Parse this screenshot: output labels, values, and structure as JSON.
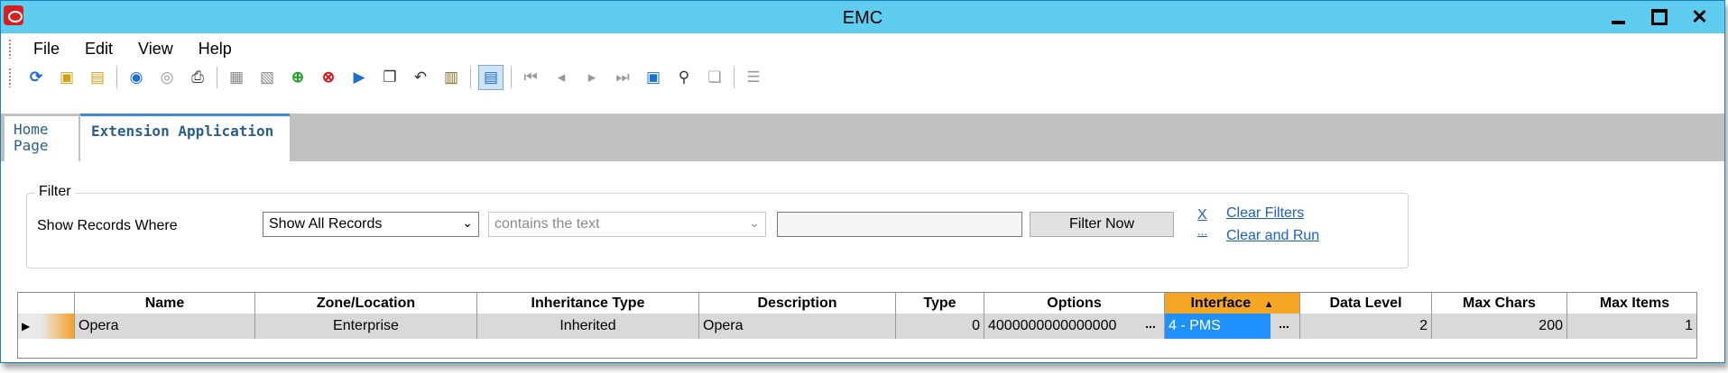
{
  "window": {
    "title": "EMC"
  },
  "menu": [
    "File",
    "Edit",
    "View",
    "Help"
  ],
  "toolbar_icons": [
    "refresh-icon",
    "new-icon",
    "new-multi-icon",
    "record-icon",
    "comment-icon",
    "print-icon",
    "save-icon",
    "save-all-icon",
    "add-icon",
    "delete-icon",
    "run-icon",
    "copy-icon",
    "undo-icon",
    "paste-icon",
    "grid-view-icon",
    "first-record-icon",
    "previous-record-icon",
    "next-record-icon",
    "last-record-icon",
    "goto-icon",
    "find-icon",
    "preview-icon",
    "list-icon"
  ],
  "tabs": [
    {
      "label": "Home\nPage"
    },
    {
      "label": "Extension Application"
    }
  ],
  "filter": {
    "legend": "Filter",
    "show_label": "Show Records Where",
    "records_select": "Show All Records",
    "condition_select": "contains the text",
    "text_value": "",
    "filter_now": "Filter Now",
    "clear_x": "X",
    "clear_dots": "...",
    "clear_filters": "Clear Filters",
    "clear_and_run": "Clear and Run"
  },
  "grid": {
    "columns": [
      "Name",
      "Zone/Location",
      "Inheritance Type",
      "Description",
      "Type",
      "Options",
      "Interface",
      "Data Level",
      "Max Chars",
      "Max Items"
    ],
    "rows": [
      {
        "name": "Opera",
        "zone": "Enterprise",
        "inheritance": "Inherited",
        "description": "Opera",
        "type": "0",
        "options": "4000000000000000",
        "interface": "4 - PMS",
        "data_level": "2",
        "max_chars": "200",
        "max_items": "1"
      }
    ],
    "ellipsis": "..."
  }
}
